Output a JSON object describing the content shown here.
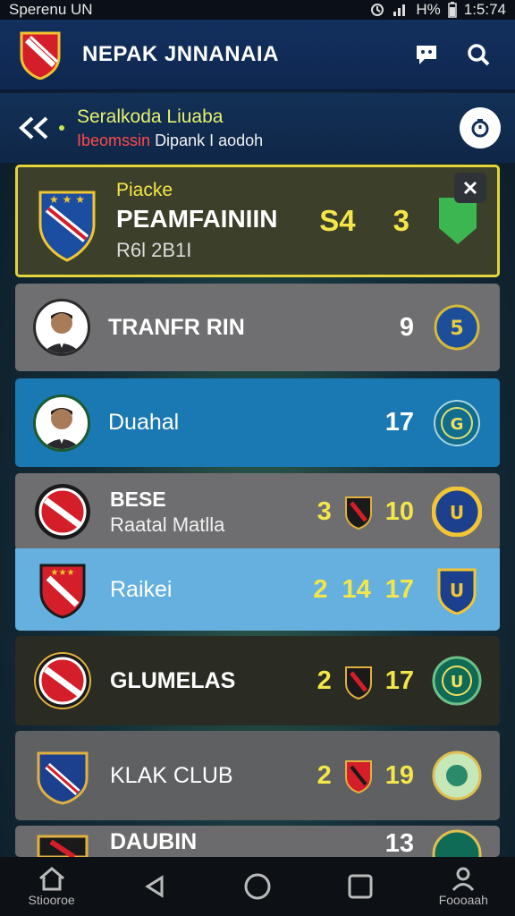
{
  "status": {
    "left_text": "Sperenu UN",
    "time": "1:5:74",
    "battery": "H%"
  },
  "header": {
    "title": "NEPAK JNNANAIA",
    "icons": [
      "chat-icon",
      "search-icon"
    ]
  },
  "subheader": {
    "title": "Seralkoda Liuaba",
    "sub_red": "Ibeomssin",
    "sub_white": "Dipank I aodoh"
  },
  "featured": {
    "tag": "Piacke",
    "name": "PEAMFAINIIN",
    "detail": "R6l 2B1I",
    "score": "S4",
    "rank": "3"
  },
  "rows": [
    {
      "name": "TRANFR RIN",
      "values": [
        "9"
      ]
    },
    {
      "name": "Duahal",
      "values": [
        "17"
      ]
    },
    {
      "name": "BESE",
      "sub": "Raatal Matlla",
      "values": [
        "3",
        "10"
      ]
    },
    {
      "name": "Raikei",
      "values": [
        "2",
        "14",
        "17"
      ]
    },
    {
      "name": "GLUMELAS",
      "values": [
        "2",
        "17"
      ]
    },
    {
      "name": "KLAK CLUB",
      "values": [
        "2",
        "19"
      ]
    },
    {
      "name": "DAUBIN",
      "values": [
        "13"
      ]
    }
  ],
  "navbar": {
    "home": "Stiooroe",
    "profile": "Foooaah"
  }
}
